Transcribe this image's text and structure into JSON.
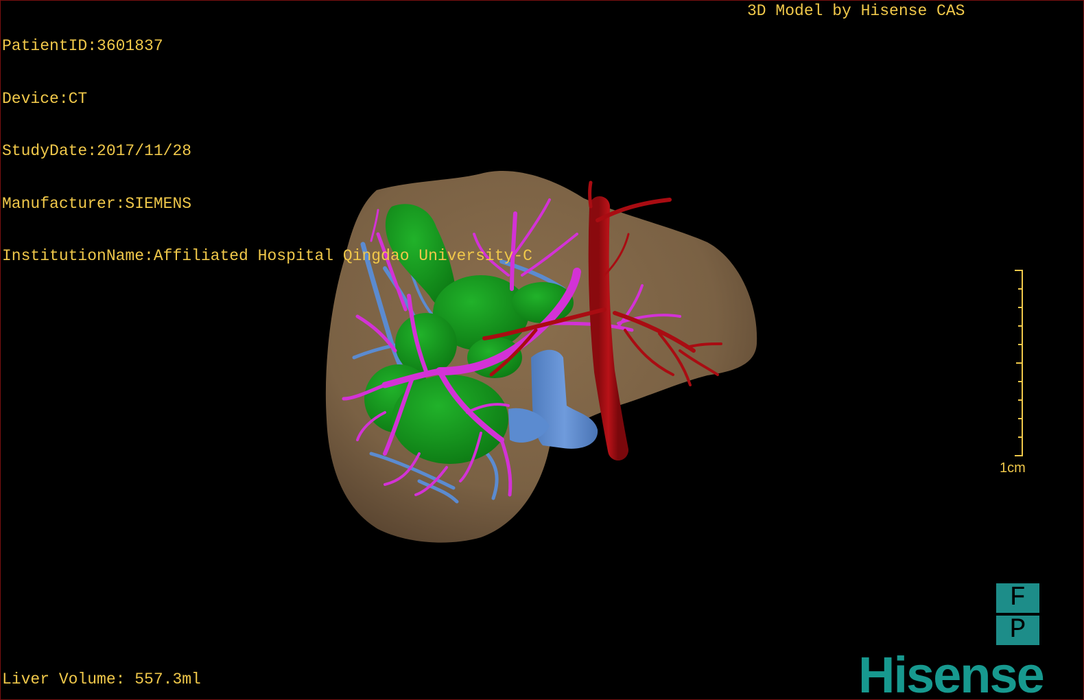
{
  "viewer": {
    "patient_info": [
      "PatientID:3601837",
      "Device:CT",
      "StudyDate:2017/11/28",
      "Manufacturer:SIEMENS",
      "InstitutionName:Affiliated Hospital Qingdao University-C"
    ],
    "credit": "3D Model by Hisense CAS",
    "liver_volume": "Liver Volume: 557.3ml",
    "scale_label": "1cm",
    "orientation": {
      "top": "F",
      "bottom": "P"
    },
    "brand": "Hisense"
  },
  "colors": {
    "text": "#f0c84a",
    "liver": "#7d6446",
    "tumor": "#139a1c",
    "portal_vein": "#d332d6",
    "hepatic_vein": "#5b8bd0",
    "artery": "#a90c12",
    "brand": "#17998f"
  }
}
